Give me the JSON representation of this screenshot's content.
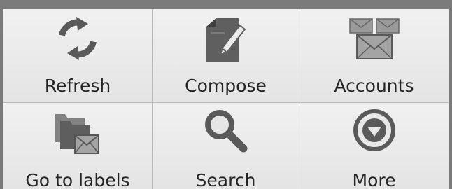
{
  "menu": {
    "items": [
      {
        "label": "Refresh",
        "icon": "refresh-icon"
      },
      {
        "label": "Compose",
        "icon": "compose-icon"
      },
      {
        "label": "Accounts",
        "icon": "accounts-icon"
      },
      {
        "label": "Go to labels",
        "icon": "labels-icon"
      },
      {
        "label": "Search",
        "icon": "search-icon"
      },
      {
        "label": "More",
        "icon": "more-icon"
      }
    ],
    "colors": {
      "frame": "#7b7b7b",
      "panel": "#e9e9e9",
      "icon": "#595959",
      "text": "#252525"
    }
  }
}
